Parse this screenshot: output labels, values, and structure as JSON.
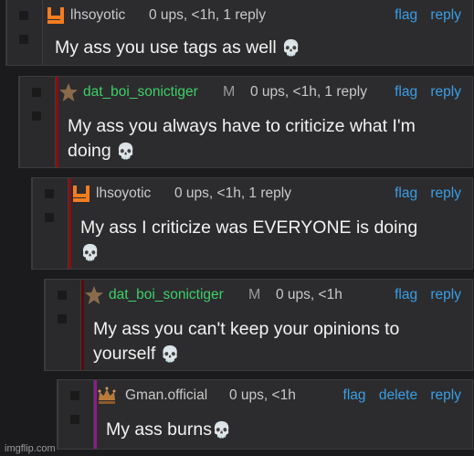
{
  "colors": {
    "background": "#1b1b1d",
    "panel": "#2c2c2e",
    "link": "#3b9ee4",
    "username_green": "#3fcf6a",
    "thread_red": "#8a0f0f",
    "thread_darkred": "#5a0a0a",
    "thread_purple": "#8e1b8e",
    "badge_orange": "#f57c1f"
  },
  "comments": [
    {
      "username": "lhsoyotic",
      "badge_icon": "orange-y-badge-icon",
      "stats": "0 ups, <1h, 1 reply",
      "links": [
        "flag",
        "reply"
      ],
      "text": "My ass you use tags as well",
      "emoji": "💀"
    },
    {
      "username": "dat_boi_sonictiger",
      "badge_icon": "brown-star-badge-icon",
      "mod_mark": "M",
      "stats": "0 ups, <1h, 1 reply",
      "links": [
        "flag",
        "reply"
      ],
      "text_line1": "My ass you always have to criticize what I'm",
      "text_line2": "doing",
      "emoji": "💀"
    },
    {
      "username": "lhsoyotic",
      "badge_icon": "orange-y-badge-icon",
      "stats": "0 ups, <1h, 1 reply",
      "links": [
        "flag",
        "reply"
      ],
      "text": "My ass I criticize was EVERYONE is doing",
      "emoji": "💀"
    },
    {
      "username": "dat_boi_sonictiger",
      "badge_icon": "brown-star-badge-icon",
      "mod_mark": "M",
      "stats": "0 ups, <1h",
      "links": [
        "flag",
        "reply"
      ],
      "text_line1": "My ass you can't keep your opinions to",
      "text_line2": "yourself",
      "emoji": "💀"
    },
    {
      "username": "Gman.official",
      "badge_icon": "crown-badge-icon",
      "stats": "0 ups, <1h",
      "links": [
        "flag",
        "delete",
        "reply"
      ],
      "text": "My ass burns",
      "emoji": "💀"
    }
  ],
  "watermark": "imgflip.com"
}
